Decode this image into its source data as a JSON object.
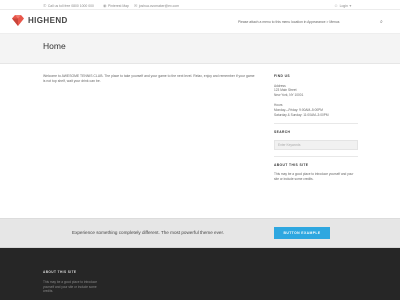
{
  "topbar": {
    "phone": "Call us toll free 0800 1000 000",
    "pinterest": "Pinterest Map",
    "email": "joshua.ovomaker@ex.com",
    "login": "Login"
  },
  "header": {
    "logo_text": "HIGHEND",
    "menu_note": "Please attach a menu to this menu location in Appearance > Menus"
  },
  "page": {
    "title": "Home"
  },
  "content": {
    "body": "Welcome to AWESOME TENNIS CLUB. The place to take yourself and your game to the next level. Relax, enjoy and remember if your game is not top shelf, wait your drink can be."
  },
  "sidebar": {
    "find_us_heading": "FIND US",
    "address_label": "Address",
    "address_line1": "123 Main Street",
    "address_line2": "New York, NY 10001",
    "hours_label": "Hours",
    "hours_line1": "Monday—Friday: 9:00AM–5:00PM",
    "hours_line2": "Saturday & Sunday: 11:00AM–3:00PM",
    "search_heading": "SEARCH",
    "search_placeholder": "Enter Keywords",
    "about_heading": "ABOUT THIS SITE",
    "about_text": "This may be a good place to introduce yourself and your site or include some credits."
  },
  "cta": {
    "text": "Experience something completely different. The most powerful theme ever.",
    "button": "BUTTON EXAMPLE"
  },
  "footer": {
    "heading": "ABOUT THIS SITE",
    "text": "This may be a good place to introduce yourself and your site or include some credits."
  },
  "colors": {
    "accent": "#2ea7e0",
    "logo_red": "#e8564a",
    "footer_bg": "#262626"
  },
  "icons": [
    "phone-icon",
    "map-pin-icon",
    "mail-icon",
    "user-icon",
    "search-icon",
    "diamond-logo-icon"
  ]
}
